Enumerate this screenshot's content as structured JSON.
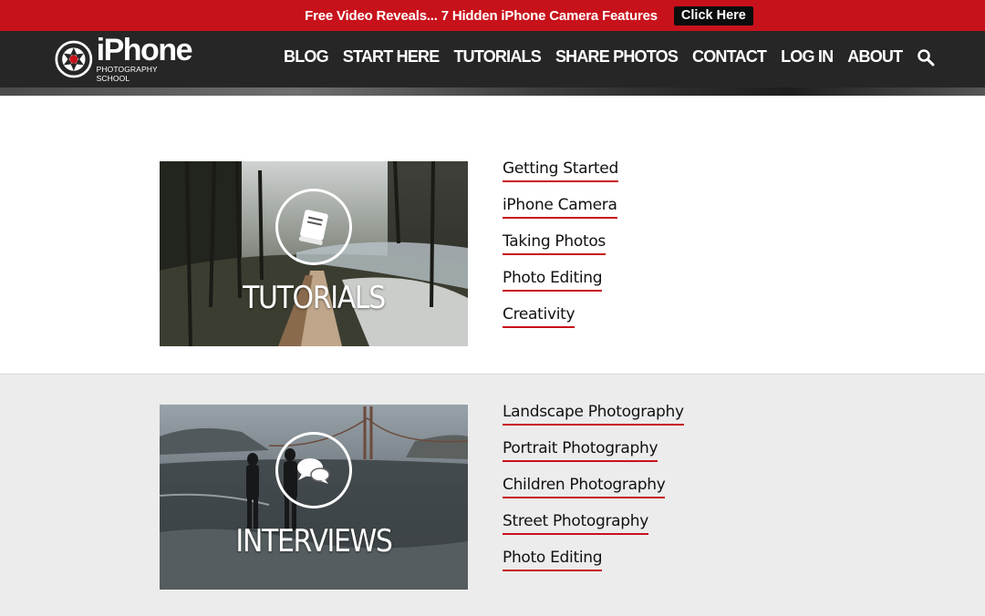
{
  "promo": {
    "text": "Free Video Reveals... 7 Hidden iPhone Camera Features",
    "button": "Click Here"
  },
  "header": {
    "logo_title": "iPhone",
    "logo_subtitle": "PHOTOGRAPHY SCHOOL",
    "nav": [
      "BLOG",
      "START HERE",
      "TUTORIALS",
      "SHARE PHOTOS",
      "CONTACT",
      "LOG IN",
      "ABOUT"
    ],
    "search_icon": "search-icon"
  },
  "sections": [
    {
      "title": "TUTORIALS",
      "icon": "book-icon",
      "links": [
        "Getting Started",
        "iPhone Camera",
        "Taking Photos",
        "Photo Editing",
        "Creativity"
      ]
    },
    {
      "title": "INTERVIEWS",
      "icon": "chat-bubbles-icon",
      "links": [
        "Landscape Photography",
        "Portrait Photography",
        "Children Photography",
        "Street Photography",
        "Photo Editing"
      ]
    }
  ],
  "colors": {
    "accent": "#c8121b",
    "header_bg": "#262626",
    "grey_section": "#ececec"
  }
}
